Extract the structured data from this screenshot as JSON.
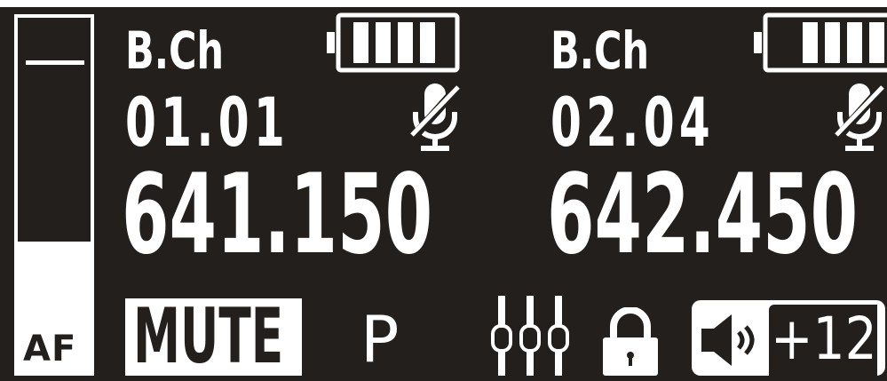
{
  "meter": {
    "label": "AF"
  },
  "channels": [
    {
      "band": "B.Ch",
      "group_channel": "01.01",
      "frequency": "641.150",
      "battery_bars": 4,
      "icon": "mic-muted-icon"
    },
    {
      "band": "B.Ch",
      "group_channel": "02.04",
      "frequency": "642.450",
      "battery_bars": 3,
      "icon": "mic-muted-icon"
    }
  ],
  "status": {
    "mute_label": "MUTE",
    "preset_label": "P",
    "volume": "+12"
  },
  "colors": {
    "background": "#231f1c",
    "foreground": "#ffffff"
  }
}
